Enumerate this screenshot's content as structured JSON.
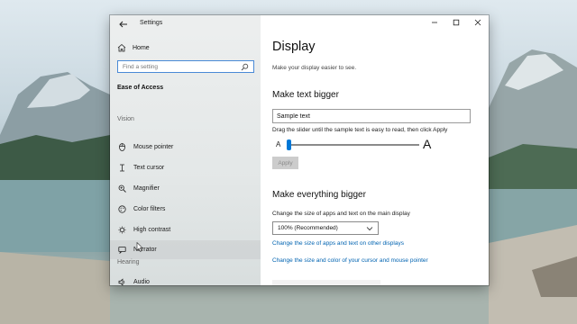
{
  "window": {
    "title": "Settings",
    "controls": {
      "minimize": "minimize-icon",
      "maximize": "maximize-icon",
      "close": "close-icon"
    }
  },
  "sidebar": {
    "home_label": "Home",
    "search_placeholder": "Find a setting",
    "section_heading": "Ease of Access",
    "groups": [
      {
        "label": "Vision",
        "items": [
          {
            "label": "Mouse pointer",
            "icon": "mouse-pointer-icon"
          },
          {
            "label": "Text cursor",
            "icon": "text-cursor-icon"
          },
          {
            "label": "Magnifier",
            "icon": "magnifier-icon"
          },
          {
            "label": "Color filters",
            "icon": "color-filters-icon"
          },
          {
            "label": "High contrast",
            "icon": "high-contrast-icon"
          },
          {
            "label": "Narrator",
            "icon": "narrator-icon",
            "hovered": true
          }
        ]
      },
      {
        "label": "Hearing",
        "items": [
          {
            "label": "Audio",
            "icon": "audio-icon"
          }
        ]
      }
    ]
  },
  "main": {
    "title": "Display",
    "subtitle": "Make your display easier to see.",
    "text_section": {
      "heading": "Make text bigger",
      "sample_value": "Sample text",
      "instruction": "Drag the slider until the sample text is easy to read, then click Apply",
      "slider_min_label": "A",
      "slider_max_label": "A",
      "slider_level": 0.01,
      "apply_label": "Apply",
      "apply_enabled": false
    },
    "everything_section": {
      "heading": "Make everything bigger",
      "instruction": "Change the size of apps and text on the main display",
      "scale_value": "100% (Recommended)",
      "link_other_displays": "Change the size of apps and text on other displays",
      "link_cursor": "Change the size and color of your cursor and mouse pointer"
    }
  },
  "colors": {
    "accent": "#0078d7",
    "link": "#0063b1",
    "search_border": "#4a8ad6"
  }
}
